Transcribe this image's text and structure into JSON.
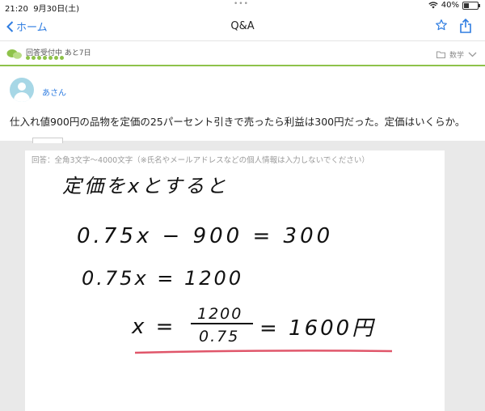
{
  "status": {
    "time": "21:20",
    "date": "9月30日(土)",
    "battery": "40%",
    "battery_level": 0.4
  },
  "nav": {
    "back_label": "ホーム",
    "title": "Q&A"
  },
  "question": {
    "status_label": "回答受付中 あと7日",
    "category": "数学",
    "asker_name": "あさん",
    "text": "仕入れ値900円の品物を定価の25パーセント引きで売ったら利益は300円だった。定価はいくらか。"
  },
  "answer": {
    "placeholder": "回答：全角3文字〜4000文字（※氏名やメールアドレスなどの個人情報は入力しないでください）",
    "handwritten": {
      "line1": "定価をxとすると",
      "line2": "0.75x − 900 = 300",
      "line3": "0.75x = 1200",
      "line4_lhs": "x =",
      "numerator": "1200",
      "denominator": "0.75",
      "line4_rhs": "= 1600円"
    }
  },
  "colors": {
    "accent": "#2f7de1",
    "green": "#8ec24a",
    "underline": "#e0566a"
  }
}
